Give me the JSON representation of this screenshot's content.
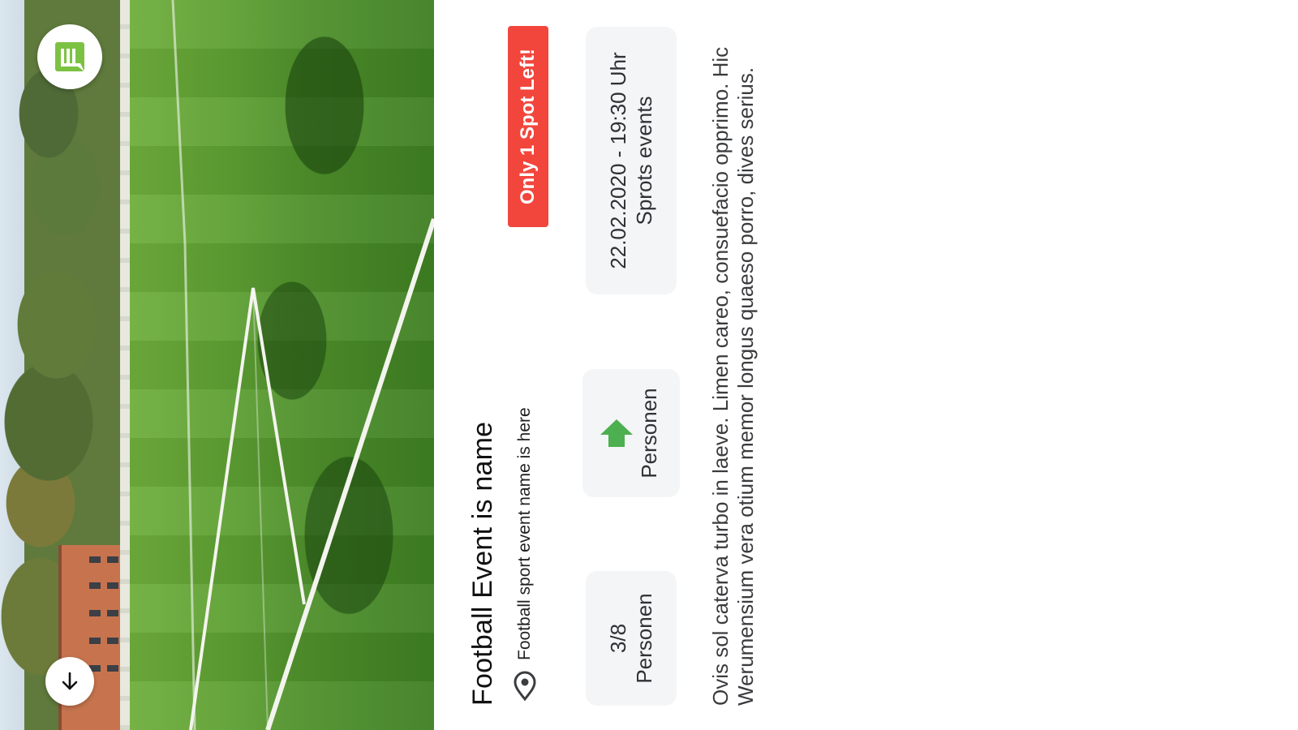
{
  "event": {
    "title": "Football Event is name",
    "location": "Football sport event name is here",
    "spots_badge": "Only 1 Spot Left!",
    "datetime": "22.02.2020 - 19:30 Uhr",
    "category": "Sprots events",
    "type_label": "Personen",
    "attendance_count": "3/8",
    "attendance_label": "Personen",
    "description": "Ovis sol caterva turbo in laeve. Limen careo, consuefacio opprimo. Hic Werumensium vera otium memor longus quaeso porro, dives serius."
  },
  "icons": {
    "logo": "app-logo-icon",
    "location": "location-pin-icon",
    "type": "house-arrow-icon",
    "scroll": "arrow-down-icon"
  },
  "colors": {
    "accent_green": "#7cc242",
    "badge_red": "#f2463d",
    "card_bg": "#f4f5f6"
  }
}
